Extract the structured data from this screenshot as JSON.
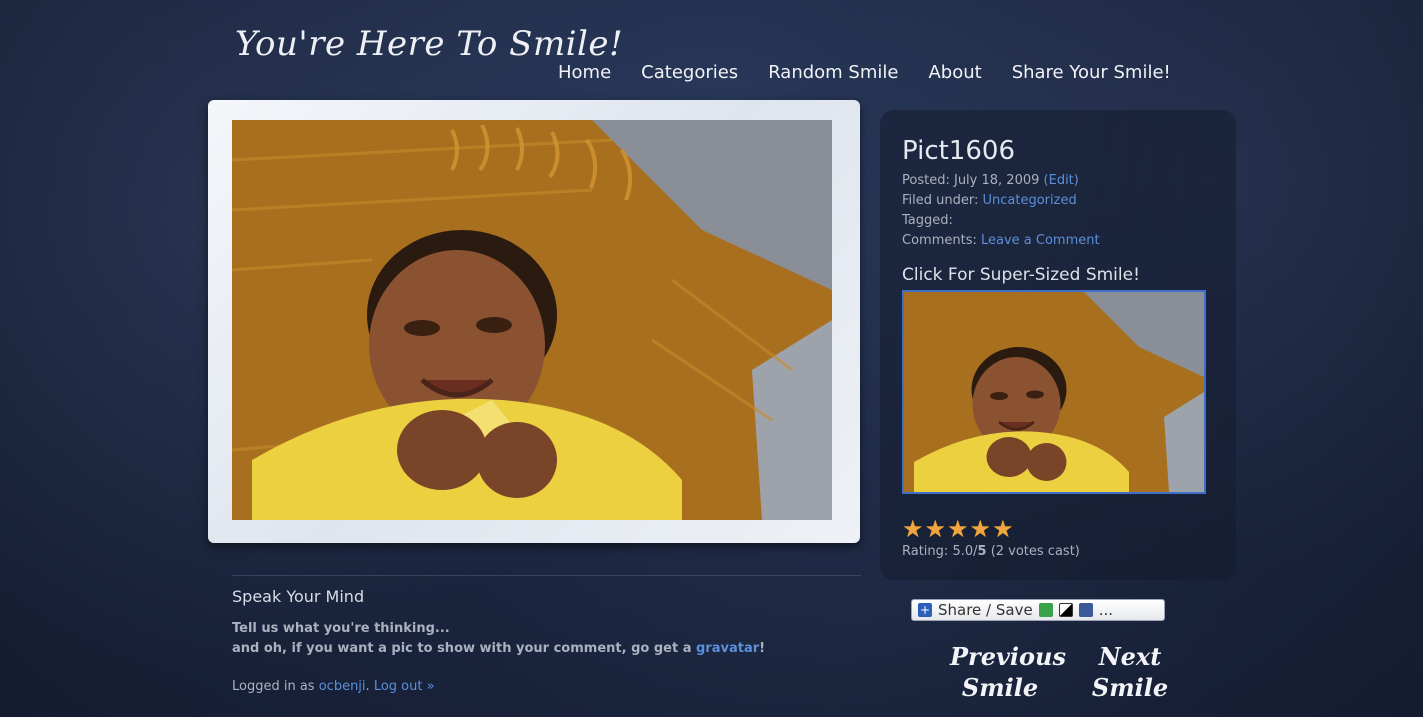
{
  "site": {
    "title": "You're Here To Smile!"
  },
  "nav": {
    "items": [
      "Home",
      "Categories",
      "Random Smile",
      "About",
      "Share Your Smile!"
    ]
  },
  "post": {
    "title": "Pict1606",
    "posted_label": "Posted:",
    "posted_date": "July 18, 2009",
    "edit_link": "(Edit)",
    "filed_label": "Filed under:",
    "category": "Uncategorized",
    "tagged_label": "Tagged:",
    "comments_label": "Comments:",
    "comments_link": "Leave a Comment",
    "super_sized_label": "Click For Super-Sized Smile!"
  },
  "rating": {
    "stars": 5,
    "max": 5,
    "label_prefix": "Rating:",
    "value_text": "5.0/",
    "max_text": "5",
    "votes_text": "(2 votes cast)",
    "star_color": "#f0a640"
  },
  "share": {
    "label": "Share / Save",
    "more": "..."
  },
  "pager": {
    "previous": [
      "Previous",
      "Smile"
    ],
    "next": [
      "Next",
      "Smile"
    ]
  },
  "comments": {
    "title": "Speak Your Mind",
    "line1": "Tell us what you're thinking...",
    "line2_prefix": "and oh, if you want a pic to show with your comment, go get a",
    "gravatar": "gravatar",
    "line2_suffix": "!",
    "logged_prefix": "Logged in as",
    "username": "ocbenji",
    "logout": "Log out »"
  },
  "colors": {
    "link": "#5b8fd9",
    "background": "#1c2742",
    "accent_border": "#3f6fc9"
  },
  "icons": [
    "share-plus-icon",
    "share-refresh-icon",
    "delicious-icon",
    "facebook-icon"
  ]
}
